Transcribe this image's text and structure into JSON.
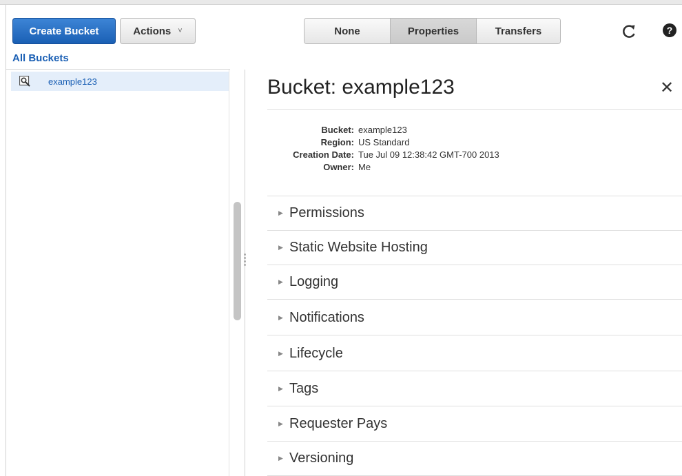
{
  "toolbar": {
    "create_label": "Create Bucket",
    "actions_label": "Actions",
    "segments": [
      "None",
      "Properties",
      "Transfers"
    ]
  },
  "list": {
    "header": "All Buckets",
    "buckets": [
      "example123"
    ]
  },
  "panel": {
    "title": "Bucket: example123",
    "close_glyph": "✕",
    "properties": [
      {
        "key": "Bucket:",
        "value": "example123"
      },
      {
        "key": "Region:",
        "value": "US Standard"
      },
      {
        "key": "Creation Date:",
        "value": "Tue Jul 09 12:38:42 GMT-700 2013"
      },
      {
        "key": "Owner:",
        "value": "Me"
      }
    ],
    "sections": [
      "Permissions",
      "Static Website Hosting",
      "Logging",
      "Notifications",
      "Lifecycle",
      "Tags",
      "Requester Pays",
      "Versioning"
    ]
  },
  "colors": {
    "accent": "#1a5fb4",
    "selected_row": "#e4eefa"
  }
}
